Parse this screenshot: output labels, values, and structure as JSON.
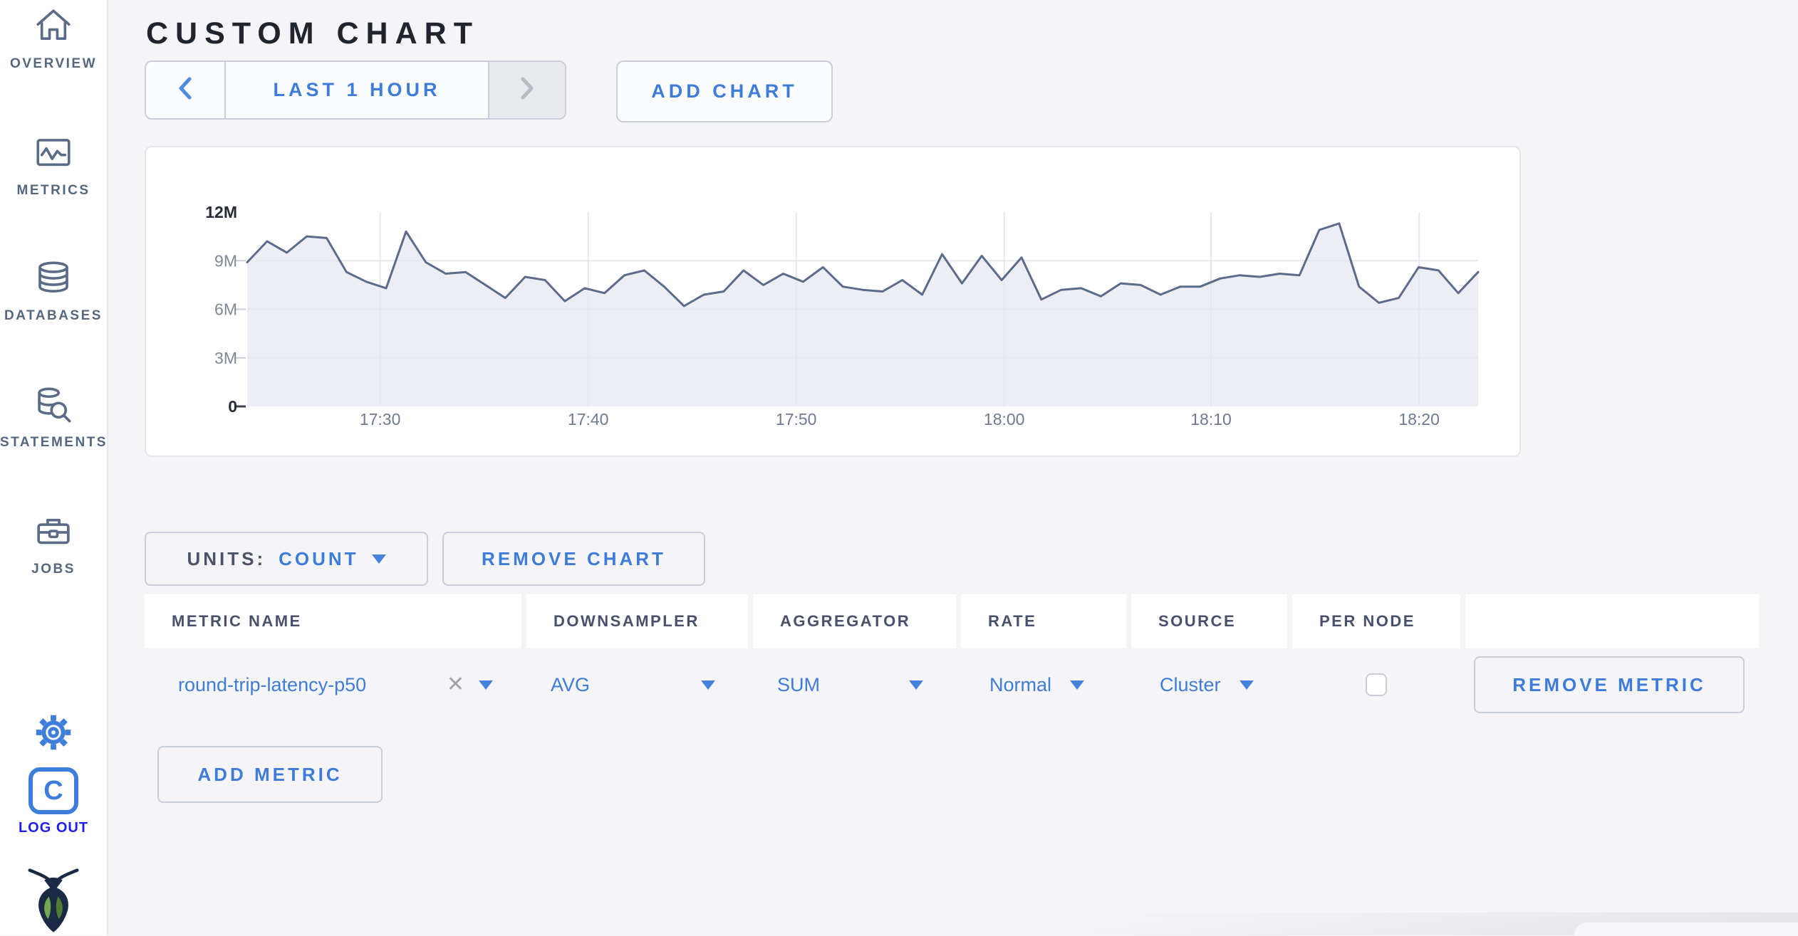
{
  "page": {
    "title": "CUSTOM CHART"
  },
  "sidebar": {
    "items": [
      {
        "label": "OVERVIEW",
        "icon": "home-icon"
      },
      {
        "label": "METRICS",
        "icon": "metrics-icon"
      },
      {
        "label": "DATABASES",
        "icon": "database-icon"
      },
      {
        "label": "STATEMENTS",
        "icon": "statements-magnifier-icon"
      },
      {
        "label": "JOBS",
        "icon": "briefcase-icon"
      }
    ],
    "logout": {
      "label": "LOG OUT",
      "monogram": "C"
    }
  },
  "toolbar": {
    "time_range_label": "LAST 1 HOUR",
    "add_chart_label": "ADD CHART"
  },
  "chart_controls": {
    "units_label": "UNITS:",
    "units_value": "COUNT",
    "remove_chart_label": "REMOVE CHART"
  },
  "metrics_table": {
    "columns": [
      "METRIC NAME",
      "DOWNSAMPLER",
      "AGGREGATOR",
      "RATE",
      "SOURCE",
      "PER NODE"
    ],
    "rows": [
      {
        "metric_name": "round-trip-latency-p50",
        "clear_icon": "✕",
        "downsampler": "AVG",
        "aggregator": "SUM",
        "rate": "Normal",
        "source": "Cluster",
        "per_node_checked": false,
        "remove_label": "REMOVE METRIC"
      }
    ],
    "add_metric_label": "ADD METRIC"
  },
  "chart_data": {
    "type": "area",
    "title": "",
    "units": "count",
    "legend_position": "none",
    "grid": true,
    "x_start_time": "17:23",
    "x_end_time": "18:23",
    "x_interval_minutes": 1,
    "ylim_millions": [
      0,
      12
    ],
    "y_ticks": [
      {
        "label": "0",
        "value": 0
      },
      {
        "label": "3M",
        "value": 3
      },
      {
        "label": "6M",
        "value": 6
      },
      {
        "label": "9M",
        "value": 9
      },
      {
        "label": "12M",
        "value": 12
      }
    ],
    "x_ticks": [
      {
        "label": "17:30",
        "pos": 0.108
      },
      {
        "label": "17:40",
        "pos": 0.277
      },
      {
        "label": "17:50",
        "pos": 0.446
      },
      {
        "label": "18:00",
        "pos": 0.615
      },
      {
        "label": "18:10",
        "pos": 0.783
      },
      {
        "label": "18:20",
        "pos": 0.952
      }
    ],
    "series": [
      {
        "name": "round-trip-latency-p50",
        "values_millions": [
          8.9,
          10.2,
          9.5,
          10.5,
          10.4,
          8.3,
          7.7,
          7.3,
          10.8,
          8.9,
          8.2,
          8.3,
          7.5,
          6.7,
          8.0,
          7.8,
          6.5,
          7.3,
          7.0,
          8.1,
          8.4,
          7.4,
          6.2,
          6.9,
          7.1,
          8.4,
          7.5,
          8.2,
          7.7,
          8.6,
          7.4,
          7.2,
          7.1,
          7.8,
          6.9,
          9.4,
          7.6,
          9.3,
          7.8,
          9.2,
          6.6,
          7.2,
          7.3,
          6.8,
          7.6,
          7.5,
          6.9,
          7.4,
          7.4,
          7.9,
          8.1,
          8.0,
          8.2,
          8.1,
          10.9,
          11.3,
          7.4,
          6.4,
          6.7,
          8.6,
          8.4,
          7.0,
          8.3
        ]
      }
    ]
  },
  "colors": {
    "accent_blue": "#3E7CD9",
    "logout_blue": "#1D1DF0",
    "sidebar_slate": "#5A6B87",
    "chart_line": "#5B6B8C",
    "chart_fill": "#ECEEF3",
    "grid_line": "#E6E8ED",
    "page_bg": "#F5F5F7"
  }
}
